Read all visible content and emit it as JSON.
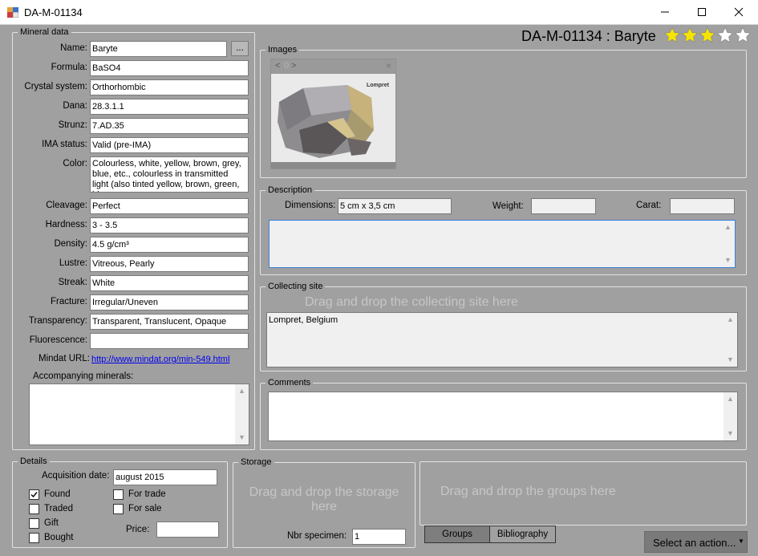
{
  "window": {
    "title": "DA-M-01134",
    "minimize_icon": "minimize-icon",
    "maximize_icon": "maximize-icon",
    "close_icon": "close-icon"
  },
  "header": {
    "heading": "DA-M-01134 : Baryte",
    "rating": 3,
    "rating_max": 5,
    "star_color": "#f5e400"
  },
  "mineral": {
    "group_label": "Mineral data",
    "fields": [
      {
        "label": "Name:",
        "value": "Baryte"
      },
      {
        "label": "Formula:",
        "value": "BaSO4"
      },
      {
        "label": "Crystal system:",
        "value": "Orthorhombic"
      },
      {
        "label": "Dana:",
        "value": "28.3.1.1"
      },
      {
        "label": "Strunz:",
        "value": "7.AD.35"
      },
      {
        "label": "IMA status:",
        "value": "Valid (pre-IMA)"
      },
      {
        "label": "Color:",
        "value": "Colourless, white, yellow, brown, grey, blue, etc., colourless in transmitted light (also tinted yellow, brown, green, blue,"
      },
      {
        "label": "Cleavage:",
        "value": "Perfect"
      },
      {
        "label": "Hardness:",
        "value": "3 - 3.5"
      },
      {
        "label": "Density:",
        "value": "4.5 g/cm³"
      },
      {
        "label": "Lustre:",
        "value": "Vitreous, Pearly"
      },
      {
        "label": "Streak:",
        "value": "White"
      },
      {
        "label": "Fracture:",
        "value": "Irregular/Uneven"
      },
      {
        "label": "Transparency:",
        "value": "Transparent, Translucent, Opaque"
      },
      {
        "label": "Fluorescence:",
        "value": ""
      }
    ],
    "browse_button": "...",
    "mindat_label": "Mindat URL:",
    "mindat_url": "http://www.mindat.org/min-549.html",
    "accompanying_label": "Accompanying minerals:"
  },
  "images": {
    "group_label": "Images",
    "nav_prev": "<",
    "nav_index": "0",
    "nav_next": ">",
    "close": "×",
    "photo_caption": "Lompret"
  },
  "description": {
    "group_label": "Description",
    "dimensions_label": "Dimensions:",
    "dimensions_value": "5 cm x 3,5 cm",
    "weight_label": "Weight:",
    "weight_value": "",
    "carat_label": "Carat:",
    "carat_value": ""
  },
  "collecting": {
    "group_label": "Collecting site",
    "drop_hint": "Drag and drop the collecting site here",
    "site_value": "Lompret, Belgium"
  },
  "comments": {
    "group_label": "Comments"
  },
  "details": {
    "group_label": "Details",
    "acquisition_label": "Acquisition date:",
    "acquisition_value": "august 2015",
    "checkboxes": [
      {
        "label": "Found",
        "checked": true
      },
      {
        "label": "Traded",
        "checked": false
      },
      {
        "label": "Gift",
        "checked": false
      },
      {
        "label": "Bought",
        "checked": false
      },
      {
        "label": "For trade",
        "checked": false
      },
      {
        "label": "For sale",
        "checked": false
      }
    ],
    "price_label": "Price:",
    "price_value": ""
  },
  "storage": {
    "group_label": "Storage",
    "drop_hint": "Drag and drop the storage here",
    "nbr_label": "Nbr specimen:",
    "nbr_value": "1"
  },
  "groups": {
    "drop_hint": "Drag and drop the groups here",
    "tab_groups": "Groups",
    "tab_bibliography": "Bibliography"
  },
  "action": {
    "label": "Select an action..."
  }
}
